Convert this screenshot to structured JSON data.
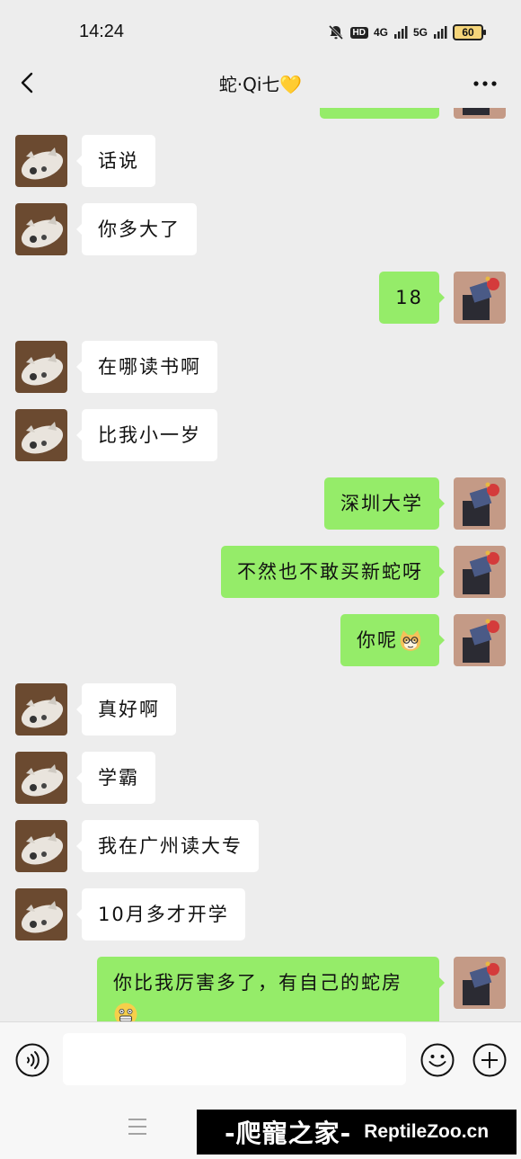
{
  "status_bar": {
    "time": "14:24",
    "hd_label": "HD",
    "network_1": "4G",
    "network_2": "5G",
    "battery": "60"
  },
  "nav": {
    "title": "蛇·Qi七💛"
  },
  "messages": [
    {
      "side": "in",
      "text": "话说"
    },
    {
      "side": "in",
      "text": "你多大了"
    },
    {
      "side": "out",
      "text": "18"
    },
    {
      "side": "in",
      "text": "在哪读书啊"
    },
    {
      "side": "in",
      "text": "比我小一岁"
    },
    {
      "side": "out",
      "text": "深圳大学"
    },
    {
      "side": "out",
      "text": "不然也不敢买新蛇呀"
    },
    {
      "side": "out",
      "text": "你呢",
      "emoji": "nerd-cat-emoji"
    },
    {
      "side": "in",
      "text": "真好啊"
    },
    {
      "side": "in",
      "text": "学霸"
    },
    {
      "side": "in",
      "text": "我在广州读大专"
    },
    {
      "side": "in",
      "text": "10月多才开学"
    },
    {
      "side": "out",
      "text": "你比我厉害多了，有自己的蛇房",
      "emoji": "grin-emoji"
    }
  ],
  "input": {
    "value": "",
    "placeholder": ""
  },
  "watermark": {
    "cn": "-爬寵之家-",
    "en": "ReptileZoo.cn"
  },
  "colors": {
    "background": "#ededed",
    "outgoing_bubble": "#95ec69",
    "incoming_bubble": "#ffffff",
    "watermark_bg": "#000000"
  }
}
